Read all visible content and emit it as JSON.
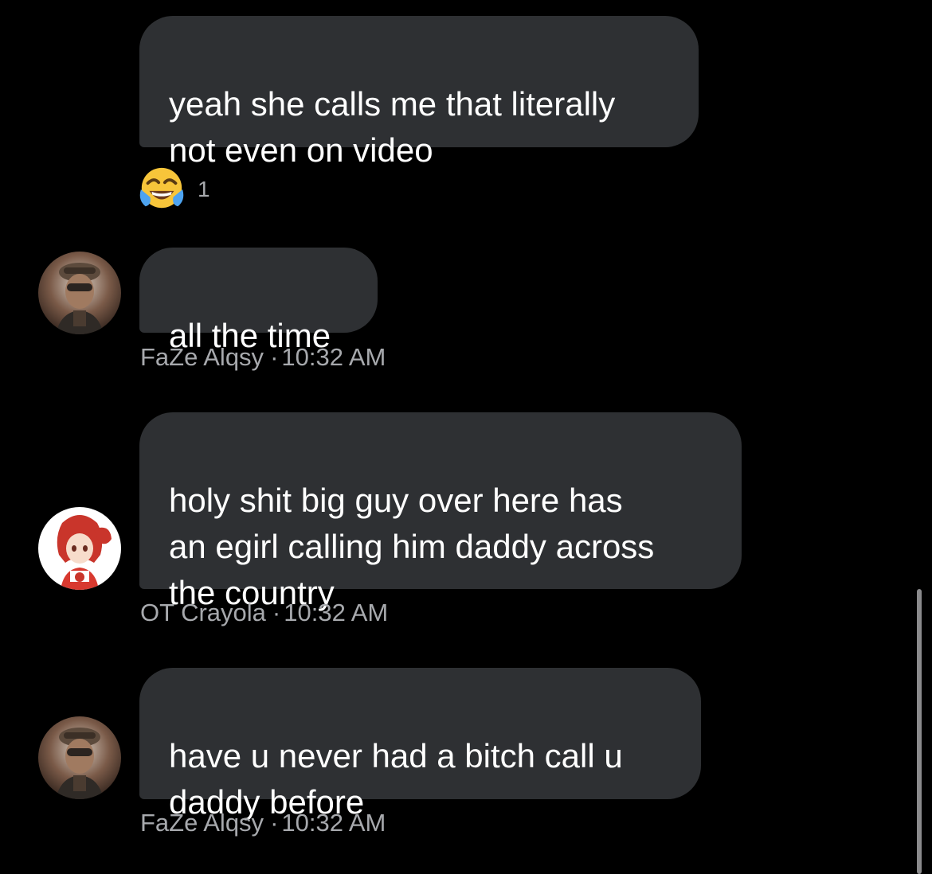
{
  "messages": [
    {
      "text": "yeah she calls me that literally\nnot even on video",
      "reaction": {
        "emoji": "face-with-tears-of-joy",
        "count": "1"
      }
    },
    {
      "text": "all the time",
      "sender": "FaZe Alqsy",
      "time": "10:32 AM"
    },
    {
      "text": "holy shit big guy over here has\nan egirl calling him daddy across\nthe country",
      "sender": "OT Crayola",
      "time": "10:32 AM"
    },
    {
      "text": "have u never had a bitch call u\ndaddy before",
      "sender": "FaZe Alqsy",
      "time": "10:32 AM"
    }
  ],
  "separator": "·",
  "colors": {
    "background": "#000000",
    "bubble": "#2e3033",
    "meta_text": "#a7a9ad",
    "message_text": "#ffffff"
  }
}
